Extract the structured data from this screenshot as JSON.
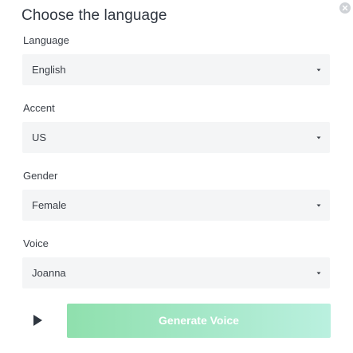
{
  "dialog": {
    "title": "Choose the language"
  },
  "fields": {
    "language": {
      "label": "Language",
      "value": "English"
    },
    "accent": {
      "label": "Accent",
      "value": "US"
    },
    "gender": {
      "label": "Gender",
      "value": "Female"
    },
    "voice": {
      "label": "Voice",
      "value": "Joanna"
    }
  },
  "actions": {
    "generate_label": "Generate Voice"
  },
  "icons": {
    "close": "close-icon",
    "caret": "chevron-down-icon",
    "play": "play-icon"
  },
  "colors": {
    "accent_gradient_start": "#8fe0ad",
    "accent_gradient_end": "#baf0df",
    "field_background": "#f4f5f6"
  }
}
